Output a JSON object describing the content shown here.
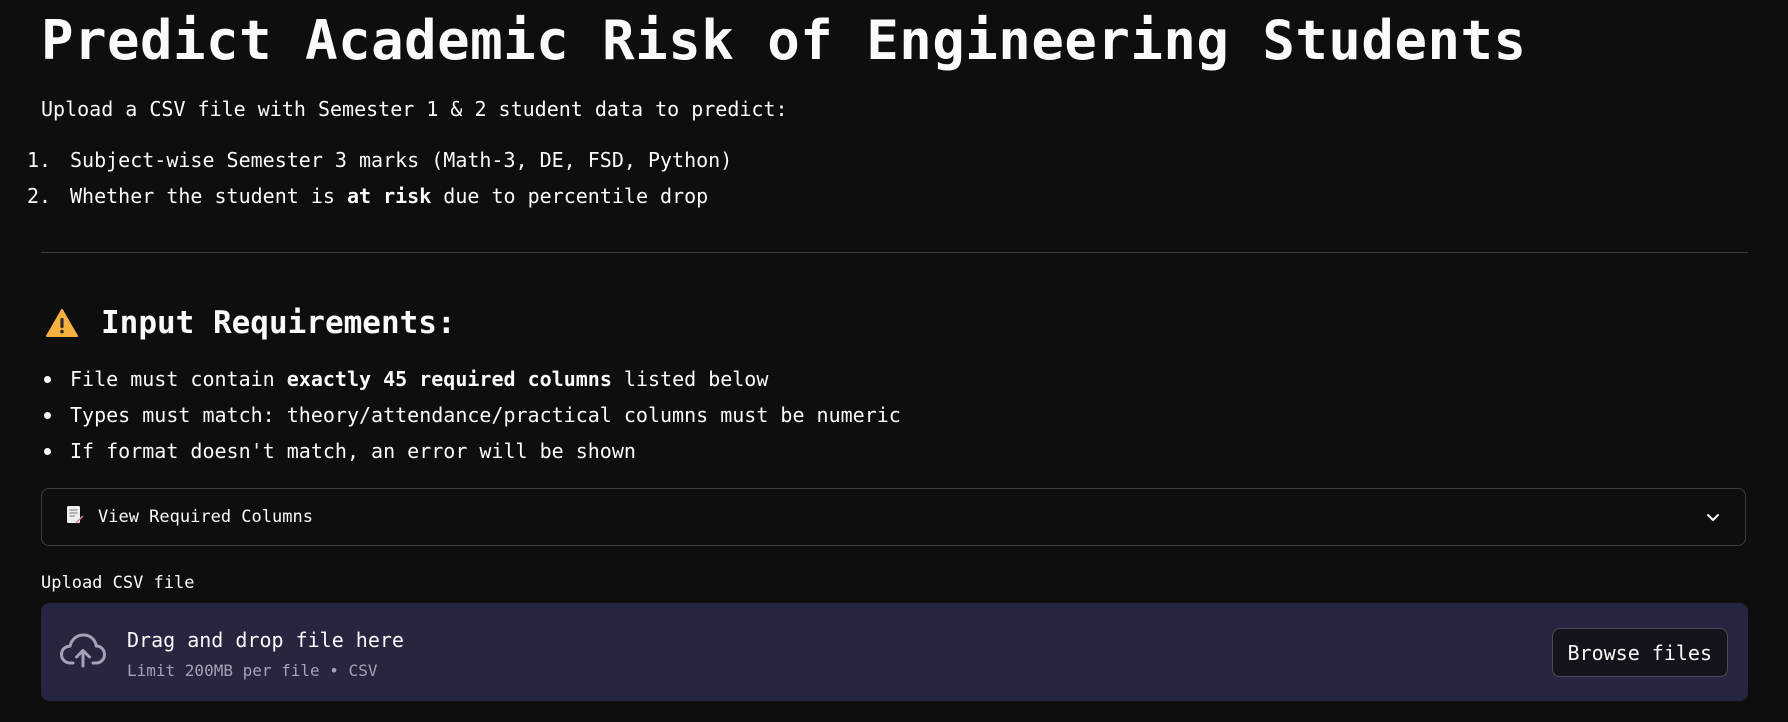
{
  "header": {
    "title": "Predict Academic Risk of Engineering Students",
    "intro": "Upload a CSV file with Semester 1 & 2 student data to predict:"
  },
  "predict_list": [
    {
      "num": "1.",
      "text": "Subject-wise Semester 3 marks (Math-3, DE, FSD, Python)"
    },
    {
      "num": "2.",
      "before": "Whether the student is ",
      "bold": "at risk",
      "after": " due to percentile drop"
    }
  ],
  "requirements": {
    "heading": "Input Requirements:",
    "icon": "warning-icon",
    "bullets": [
      {
        "before": "File must contain ",
        "bold": "exactly 45 required columns",
        "after": " listed below"
      },
      {
        "text": "Types must match: theory/attendance/practical columns must be numeric"
      },
      {
        "text": "If format doesn't match, an error will be shown"
      }
    ]
  },
  "expander": {
    "icon": "memo-icon",
    "label": "View Required Columns",
    "expanded": false
  },
  "uploader": {
    "label": "Upload CSV file",
    "drop_text": "Drag and drop file here",
    "limit_text": "Limit 200MB per file • CSV",
    "browse_label": "Browse files",
    "icon": "cloud-upload-icon"
  },
  "colors": {
    "background": "#0e0e0e",
    "text": "#fafafa",
    "dropzone": "#262640",
    "warning": "#f5b041"
  }
}
